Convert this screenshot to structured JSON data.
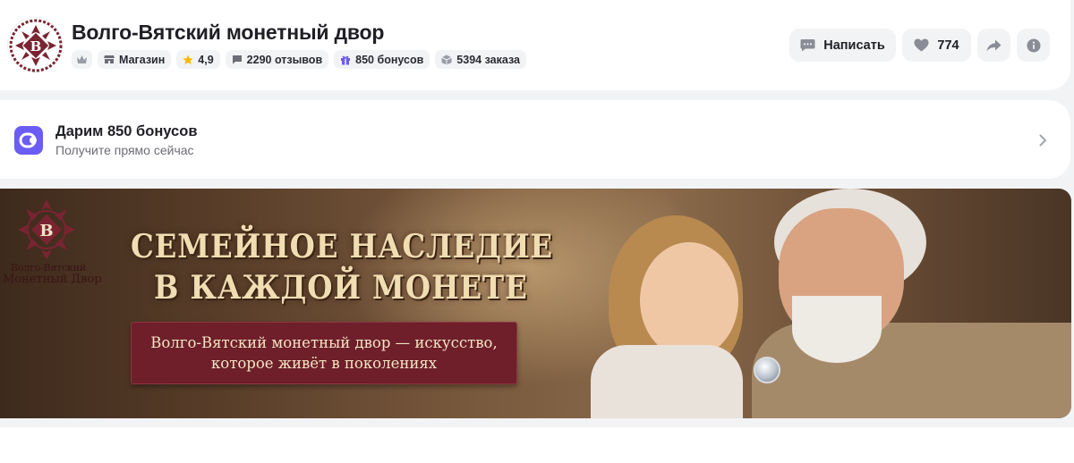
{
  "header": {
    "shop_name": "Волго-Вятский монетный двор",
    "chips": {
      "store": "Магазин",
      "rating": "4,9",
      "reviews": "2290 отзывов",
      "bonuses": "850 бонусов",
      "orders": "5394 заказа"
    },
    "actions": {
      "write_label": "Написать",
      "favorites_count": "774"
    }
  },
  "bonus_banner": {
    "title": "Дарим 850 бонусов",
    "subtitle": "Получите прямо сейчас"
  },
  "promo_banner": {
    "brand_line1": "Волго-Вятский",
    "brand_line2": "Монетный Двор",
    "headline_line1": "Семейное наследие",
    "headline_line2": "в каждой монете",
    "ribbon_text": "Волго-Вятский монетный двор — искусство, которое живёт в поколениях"
  },
  "colors": {
    "accent_purple": "#6b5cf5",
    "star": "#ffb800",
    "logo_red": "#7a2431",
    "ribbon": "#6e1f2a"
  }
}
